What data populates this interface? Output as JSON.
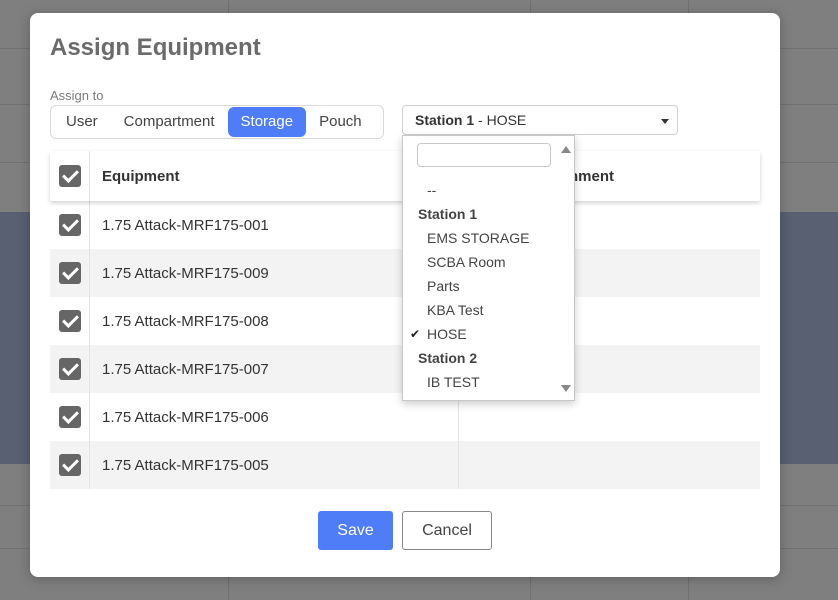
{
  "modal": {
    "title": "Assign Equipment"
  },
  "assign_to": {
    "label": "Assign to",
    "options": [
      "User",
      "Compartment",
      "Storage",
      "Pouch"
    ],
    "active": "Storage"
  },
  "location_select": {
    "group": "Station 1",
    "separator": " - ",
    "value": "HOSE"
  },
  "table": {
    "headers": {
      "equipment": "Equipment",
      "assignment": "nment"
    },
    "rows": [
      {
        "equipment": "1.75 Attack-MRF175-001",
        "checked": true
      },
      {
        "equipment": "1.75 Attack-MRF175-009",
        "checked": true
      },
      {
        "equipment": "1.75 Attack-MRF175-008",
        "checked": true
      },
      {
        "equipment": "1.75 Attack-MRF175-007",
        "checked": true
      },
      {
        "equipment": "1.75 Attack-MRF175-006",
        "checked": true
      },
      {
        "equipment": "1.75 Attack-MRF175-005",
        "checked": true
      }
    ]
  },
  "dropdown": {
    "search_value": "",
    "items": [
      {
        "label": "--",
        "type": "option"
      },
      {
        "label": "Station 1",
        "type": "group"
      },
      {
        "label": "EMS STORAGE",
        "type": "option"
      },
      {
        "label": "SCBA Room",
        "type": "option"
      },
      {
        "label": "Parts",
        "type": "option"
      },
      {
        "label": "KBA Test",
        "type": "option"
      },
      {
        "label": "HOSE",
        "type": "option",
        "selected": true
      },
      {
        "label": "Station 2",
        "type": "group"
      },
      {
        "label": "IB TEST",
        "type": "option"
      }
    ],
    "check_glyph": "✔"
  },
  "buttons": {
    "save": "Save",
    "cancel": "Cancel"
  },
  "colors": {
    "primary": "#4f7cf7",
    "checkbox": "#666666"
  }
}
